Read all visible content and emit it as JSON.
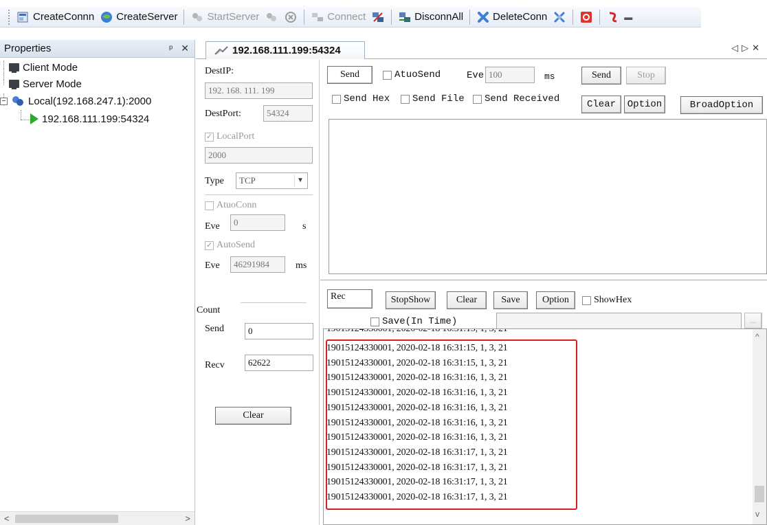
{
  "toolbar": {
    "items": [
      {
        "label": "CreateConnn",
        "icon": "create-connection-icon",
        "enabled": true
      },
      {
        "label": "CreateServer",
        "icon": "create-server-icon",
        "enabled": true
      },
      {
        "label": "StartServer",
        "icon": "start-server-icon",
        "enabled": false
      },
      {
        "label": "Connect",
        "icon": "connect-icon",
        "enabled": false
      },
      {
        "label": "DisconnAll",
        "icon": "disconnect-all-icon",
        "enabled": true
      },
      {
        "label": "DeleteConn",
        "icon": "delete-connection-icon",
        "enabled": true
      }
    ]
  },
  "properties": {
    "title": "Properties",
    "pin": "ᵖ",
    "close": "×",
    "tree": {
      "client_mode": "Client Mode",
      "server_mode": "Server Mode",
      "local": "Local(192.168.247.1):2000",
      "connection": "192.168.111.199:54324"
    }
  },
  "document": {
    "tab_title": "192.168.111.199:54324",
    "tab_controls": "◁ ▷ ×"
  },
  "settings": {
    "dest_ip_label": "DestIP:",
    "dest_ip": "192. 168. 111. 199",
    "dest_port_label": "DestPort:",
    "dest_port": "54324",
    "local_port_label": "LocalPort",
    "local_port_checked": true,
    "local_port": "2000",
    "type_label": "Type",
    "type_value": "TCP",
    "auto_conn_label": "AtuoConn",
    "auto_conn_checked": false,
    "eve_label": "Eve",
    "eve_conn_value": "0",
    "eve_conn_unit": "s",
    "auto_send_label": "AutoSend",
    "auto_send_checked": true,
    "eve_send_value": "46291984",
    "eve_send_unit": "ms",
    "count_label": "Count",
    "send_label": "Send",
    "send_count": "0",
    "recv_label": "Recv",
    "recv_count": "62622",
    "clear_label": "Clear"
  },
  "send_panel": {
    "send_tab": "Send",
    "auto_send_label": "AtuoSend",
    "auto_send_checked": false,
    "eve_label": "Eve",
    "eve_value": "100",
    "eve_unit": "ms",
    "send_button": "Send",
    "stop_button": "Stop",
    "send_hex": "Send Hex",
    "send_file": "Send File",
    "send_received": "Send Received",
    "clear_button": "Clear",
    "option_button": "Option",
    "broad_option_button": "BroadOption"
  },
  "rec_panel": {
    "rec_tab": "Rec",
    "stop_show": "StopShow",
    "clear": "Clear",
    "save": "Save",
    "option": "Option",
    "show_hex": "ShowHex",
    "save_in_time": "Save(In Time)",
    "browse": "...",
    "lines": [
      "19015124330001, 2020-02-18  16:31:15, 1, 3, 21",
      "19015124330001, 2020-02-18  16:31:15, 1, 3, 21",
      "19015124330001, 2020-02-18  16:31:16, 1, 3, 21",
      "19015124330001, 2020-02-18  16:31:16, 1, 3, 21",
      "19015124330001, 2020-02-18  16:31:16, 1, 3, 21",
      "19015124330001, 2020-02-18  16:31:16, 1, 3, 21",
      "19015124330001, 2020-02-18  16:31:16, 1, 3, 21",
      "19015124330001, 2020-02-18  16:31:17, 1, 3, 21",
      "19015124330001, 2020-02-18  16:31:17, 1, 3, 21",
      "19015124330001, 2020-02-18  16:31:17, 1, 3, 21",
      "19015124330001, 2020-02-18  16:31:17, 1, 3, 21"
    ]
  },
  "colors": {
    "highlight": "#d81e1e",
    "play": "#2ea82e"
  }
}
